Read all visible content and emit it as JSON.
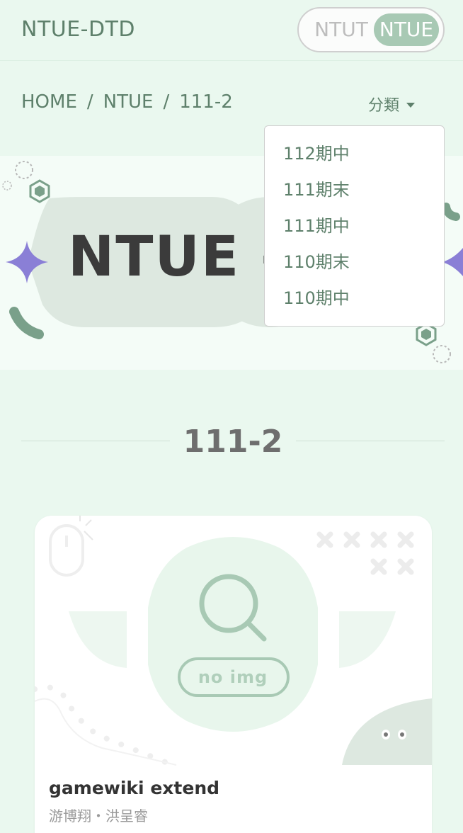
{
  "navbar": {
    "brand": "NTUE-DTD",
    "school_toggle": {
      "options": [
        "NTUT",
        "NTUE"
      ],
      "active": "NTUE"
    }
  },
  "breadcrumb": {
    "items": [
      "HOME",
      "NTUE",
      "111-2"
    ],
    "separator": "/"
  },
  "category_menu": {
    "label": "分類",
    "expanded": true,
    "items": [
      "112期中",
      "111期末",
      "111期中",
      "110期末",
      "110期中"
    ]
  },
  "hero": {
    "title": "NTUE  -"
  },
  "section": {
    "title": "111-2"
  },
  "projects": [
    {
      "title": "gamewiki extend",
      "authors": "游博翔・洪呈睿",
      "image_placeholder": "no img"
    }
  ],
  "colors": {
    "page_background": "#eaf8ef",
    "brand_green": "#5e806b",
    "accent_green": "#a8c9b4",
    "sparkle_purple": "#8a7fd6",
    "blob_green": "#dde8e0"
  }
}
